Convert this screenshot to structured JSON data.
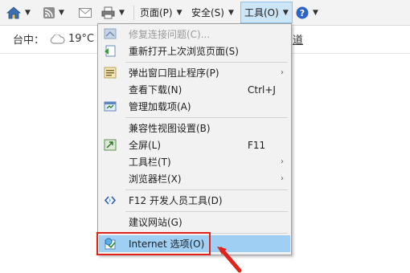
{
  "toolbar": {
    "page_label": "页面(P)",
    "security_label": "安全(S)",
    "tools_label": "工具(O)",
    "arrow": "▼"
  },
  "page": {
    "city": "台中：",
    "temperature": "19°C",
    "link_text": "道"
  },
  "menu": {
    "items": [
      {
        "label": "修复连接问题(C)...",
        "icon": "repair-icon",
        "disabled": true
      },
      {
        "label": "重新打开上次浏览页面(S)",
        "icon": "reopen-icon"
      },
      {
        "label": "弹出窗口阻止程序(P)",
        "icon": "popup-blocker-icon",
        "submenu": true
      },
      {
        "label": "查看下载(N)",
        "shortcut": "Ctrl+J"
      },
      {
        "label": "管理加载项(A)",
        "icon": "addons-icon"
      },
      {
        "label": "兼容性视图设置(B)"
      },
      {
        "label": "全屏(L)",
        "icon": "fullscreen-icon",
        "shortcut": "F11"
      },
      {
        "label": "工具栏(T)",
        "submenu": true
      },
      {
        "label": "浏览器栏(X)",
        "submenu": true
      },
      {
        "label": "F12 开发人员工具(D)",
        "icon": "devtools-icon"
      },
      {
        "label": "建议网站(G)"
      },
      {
        "label": "Internet 选项(O)",
        "icon": "internet-options-icon",
        "highlighted": true
      }
    ],
    "submenu_glyph": "›"
  },
  "colors": {
    "highlight": "#9fcff3",
    "annotation_red": "#e0241c"
  }
}
